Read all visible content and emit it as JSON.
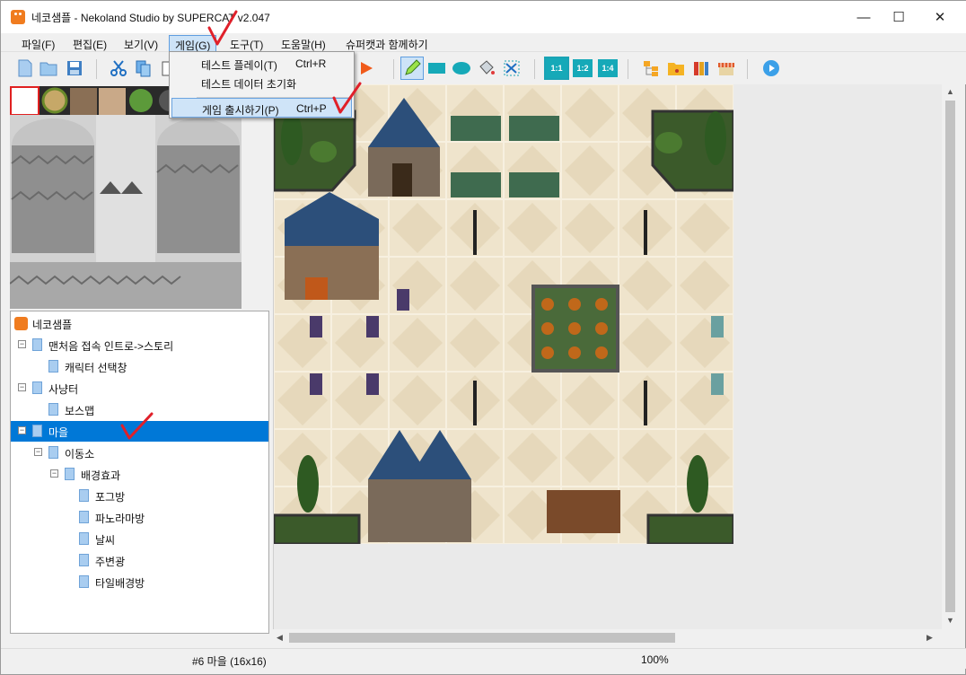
{
  "window": {
    "title": "네코샘플 - Nekoland Studio by SUPERCAT v2.047"
  },
  "controls": {
    "minimize": "—",
    "maximize": "☐",
    "close": "✕"
  },
  "menubar": {
    "items": [
      {
        "label": "파일(F)"
      },
      {
        "label": "편집(E)"
      },
      {
        "label": "보기(V)"
      },
      {
        "label": "게임(G)"
      },
      {
        "label": "도구(T)"
      },
      {
        "label": "도움말(H)"
      },
      {
        "label": "슈퍼캣과 함께하기"
      }
    ]
  },
  "game_menu": {
    "items": [
      {
        "label": "테스트 플레이(T)",
        "shortcut": "Ctrl+R"
      },
      {
        "label": "테스트 데이터 초기화",
        "shortcut": ""
      },
      {
        "label": "게임 출시하기(P)",
        "shortcut": "Ctrl+P"
      }
    ]
  },
  "toolbar": {
    "zoom_1_1": "1:1",
    "zoom_1_2": "1:2",
    "zoom_1_4": "1:4"
  },
  "tree": {
    "root": "네코샘플",
    "items": [
      {
        "label": "맨처음 접속 인트로->스토리"
      },
      {
        "label": "캐릭터 선택창"
      },
      {
        "label": "사냥터"
      },
      {
        "label": "보스맵"
      },
      {
        "label": "마을"
      },
      {
        "label": "이동소"
      },
      {
        "label": "배경효과"
      },
      {
        "label": "포그방"
      },
      {
        "label": "파노라마방"
      },
      {
        "label": "날씨"
      },
      {
        "label": "주변광"
      },
      {
        "label": "타일배경방"
      }
    ]
  },
  "status": {
    "map": "#6 마을 (16x16)",
    "zoom": "100%"
  },
  "colors": {
    "selection": "#0078d7",
    "accent_orange": "#f07c1f",
    "annotation_red": "#e0202a"
  }
}
